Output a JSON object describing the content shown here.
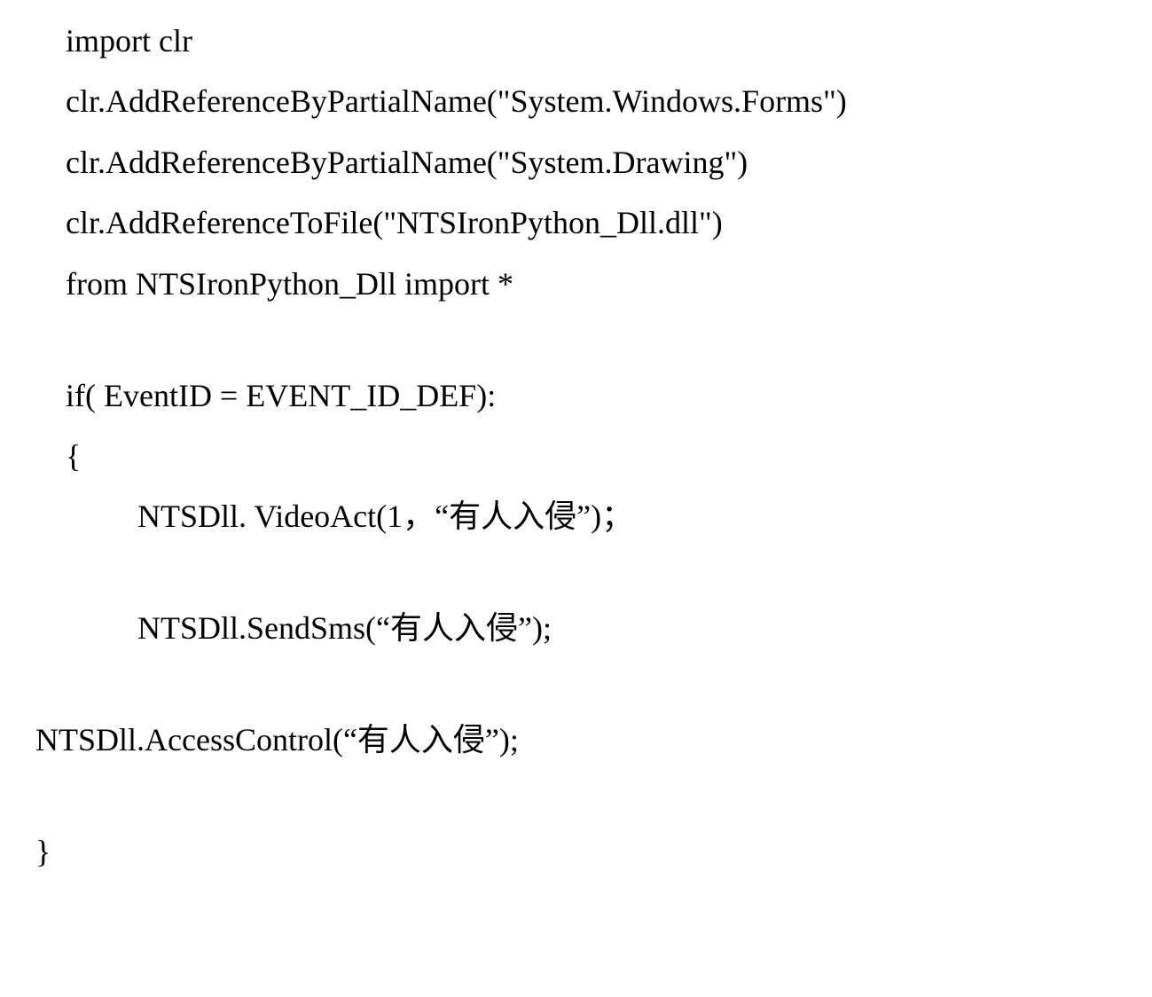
{
  "lines": {
    "l1": "import clr",
    "l2": "clr.AddReferenceByPartialName(\"System.Windows.Forms\")",
    "l3": "clr.AddReferenceByPartialName(\"System.Drawing\")",
    "l4": "clr.AddReferenceToFile(\"NTSIronPython_Dll.dll\")",
    "l5": "from NTSIronPython_Dll import *",
    "l6": "if( EventID = EVENT_ID_DEF):",
    "l7": "{",
    "l8": "NTSDll. VideoAct(1，“有人入侵”)；",
    "l9": "NTSDll.SendSms(“有人入侵”);",
    "l10": "NTSDll.AccessControl(“有人入侵”);",
    "l11": "}"
  }
}
